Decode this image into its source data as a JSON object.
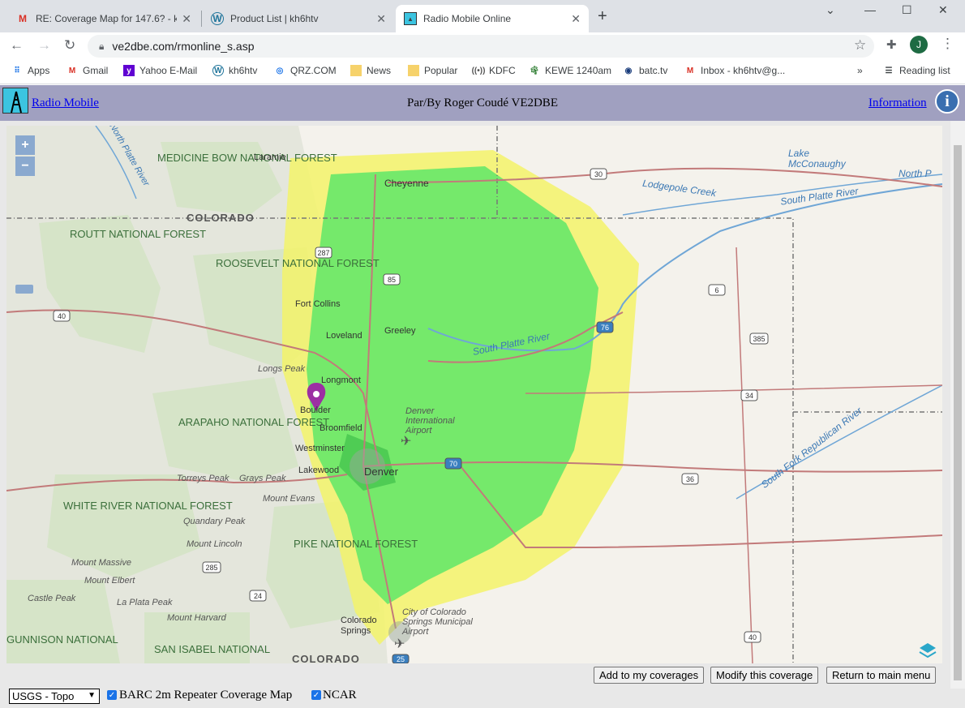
{
  "browser": {
    "tabs": [
      {
        "title": "RE: Coverage Map for 147.6? - kh",
        "icon": "gmail-icon"
      },
      {
        "title": "Product List | kh6htv",
        "icon": "wordpress-icon"
      },
      {
        "title": "Radio Mobile Online",
        "icon": "radio-mobile-icon"
      }
    ],
    "url": "ve2dbe.com/rmonline_s.asp",
    "avatar_letter": "J",
    "bookmarks": [
      {
        "label": "Apps"
      },
      {
        "label": "Gmail"
      },
      {
        "label": "Yahoo E-Mail"
      },
      {
        "label": "kh6htv"
      },
      {
        "label": "QRZ.COM"
      },
      {
        "label": "News"
      },
      {
        "label": "Popular"
      },
      {
        "label": "KDFC"
      },
      {
        "label": "KEWE 1240am"
      },
      {
        "label": "batc.tv"
      },
      {
        "label": "Inbox - kh6htv@g..."
      }
    ],
    "overflow": "»",
    "reading_list": "Reading list"
  },
  "app": {
    "title_link": "Radio Mobile",
    "byline": "Par/By Roger Coudé VE2DBE",
    "info_link": "Information"
  },
  "map": {
    "zoom_in": "+",
    "zoom_out": "−",
    "labels": {
      "medicine_bow": "MEDICINE BOW NATIONAL FOREST",
      "laramie": "Laramie",
      "cheyenne": "Cheyenne",
      "colorado_n": "COLORADO",
      "colorado_s": "COLORADO",
      "routt": "ROUTT NATIONAL FOREST",
      "roosevelt": "ROOSEVELT NATIONAL FOREST",
      "fort_collins": "Fort Collins",
      "loveland": "Loveland",
      "greeley": "Greeley",
      "longs_peak": "Longs Peak",
      "longmont": "Longmont",
      "boulder": "Boulder",
      "arapaho": "ARAPAHO NATIONAL FOREST",
      "broomfield": "Broomfield",
      "westminster": "Westminster",
      "lakewood": "Lakewood",
      "denver": "Denver",
      "dia": "Denver International Airport",
      "torreys": "Torreys Peak",
      "grays": "Grays Peak",
      "mount_evans": "Mount Evans",
      "white_river": "WHITE RIVER NATIONAL FOREST",
      "quandary": "Quandary Peak",
      "lincoln": "Mount Lincoln",
      "pike": "PIKE NATIONAL FOREST",
      "massive": "Mount Massive",
      "elbert": "Mount Elbert",
      "castle": "Castle Peak",
      "laplata": "La Plata Peak",
      "harvard": "Mount Harvard",
      "gunnison": "GUNNISON NATIONAL",
      "san_isabel": "SAN ISABEL NATIONAL",
      "colorado_springs": "Colorado Springs",
      "cos_airport": "City of Colorado Springs Municipal Airport",
      "south_platte": "South Platte River",
      "south_platte_ne": "South Platte River",
      "north_platte": "North Platte River",
      "lodgepole": "Lodgepole Creek",
      "north_p": "North P",
      "lake": "Lake McConaughy",
      "rep_river": "South Fork Republican River"
    },
    "shields": [
      "30",
      "287",
      "85",
      "40",
      "6",
      "76",
      "385",
      "34",
      "70",
      "36",
      "285",
      "24",
      "40",
      "25"
    ]
  },
  "buttons": {
    "add": "Add to my coverages",
    "modify": "Modify this coverage",
    "return": "Return to main menu"
  },
  "bottom": {
    "basemap_selected": "USGS - Topo",
    "layer1": "BARC 2m Repeater Coverage Map",
    "layer2": "NCAR"
  }
}
